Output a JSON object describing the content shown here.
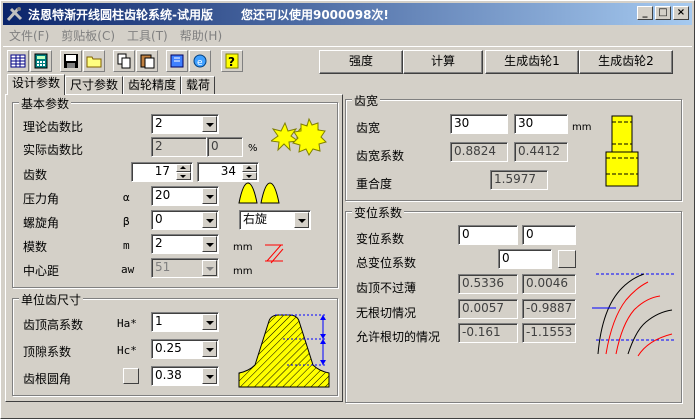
{
  "window": {
    "title": "法恩特渐开线圆柱齿轮系统-试用版",
    "trial_notice": "您还可以使用9000098次!"
  },
  "menu": [
    "文件(F)",
    "剪贴板(C)",
    "工具(T)",
    "帮助(H)"
  ],
  "toolbar_icons": [
    "table-icon",
    "calculator-icon",
    "save-icon",
    "open-folder-icon",
    "copy-icon",
    "paste-icon",
    "book-icon",
    "globe-icon",
    "help-icon"
  ],
  "toolbar_buttons": {
    "strength": "强度",
    "calculate": "计算",
    "gen_gear1": "生成齿轮1",
    "gen_gear2": "生成齿轮2"
  },
  "tabs": [
    "设计参数",
    "尺寸参数",
    "齿轮精度",
    "载荷"
  ],
  "basic": {
    "title": "基本参数",
    "ratio_label": "理论齿数比",
    "ratio_value": "2",
    "actual_ratio_label": "实际齿数比",
    "actual_ratio_value": "2",
    "actual_ratio_error": "0",
    "percent": "%",
    "teeth_label": "齿数",
    "z1": "17",
    "z2": "34",
    "pressure_label": "压力角",
    "pressure_sym": "α",
    "pressure_value": "20",
    "helix_label": "螺旋角",
    "helix_sym": "β",
    "helix_value": "0",
    "helix_dir": "右旋",
    "module_label": "模数",
    "module_sym": "m",
    "module_value": "2",
    "module_unit": "mm",
    "center_label": "中心距",
    "center_sym": "aw",
    "center_value": "51",
    "center_unit": "mm"
  },
  "unit_tooth": {
    "title": "单位齿尺寸",
    "addendum_label": "齿顶高系数",
    "addendum_sym": "Ha*",
    "addendum_value": "1",
    "clearance_label": "顶隙系数",
    "clearance_sym": "Hc*",
    "clearance_value": "0.25",
    "fillet_label": "齿根圆角",
    "fillet_value": "0.38"
  },
  "width": {
    "title": "齿宽",
    "width_label": "齿宽",
    "w1": "30",
    "w2": "30",
    "unit": "mm",
    "coef_label": "齿宽系数",
    "c1": "0.8824",
    "c2": "0.4412",
    "overlap_label": "重合度",
    "overlap_value": "1.5977"
  },
  "shift": {
    "title": "变位系数",
    "shift_label": "变位系数",
    "x1": "0",
    "x2": "0",
    "total_label": "总变位系数",
    "total_value": "0",
    "tip_label": "齿顶不过薄",
    "tip1": "0.5336",
    "tip2": "0.0046",
    "undercut_label": "无根切情况",
    "uc1": "0.0057",
    "uc2": "-0.9887",
    "allow_label": "允许根切的情况",
    "al1": "-0.161",
    "al2": "-1.1553"
  },
  "colors": {
    "gear_yellow": "#ffff00",
    "dim_blue": "#0000ff",
    "hatch_red": "#ff0000"
  }
}
